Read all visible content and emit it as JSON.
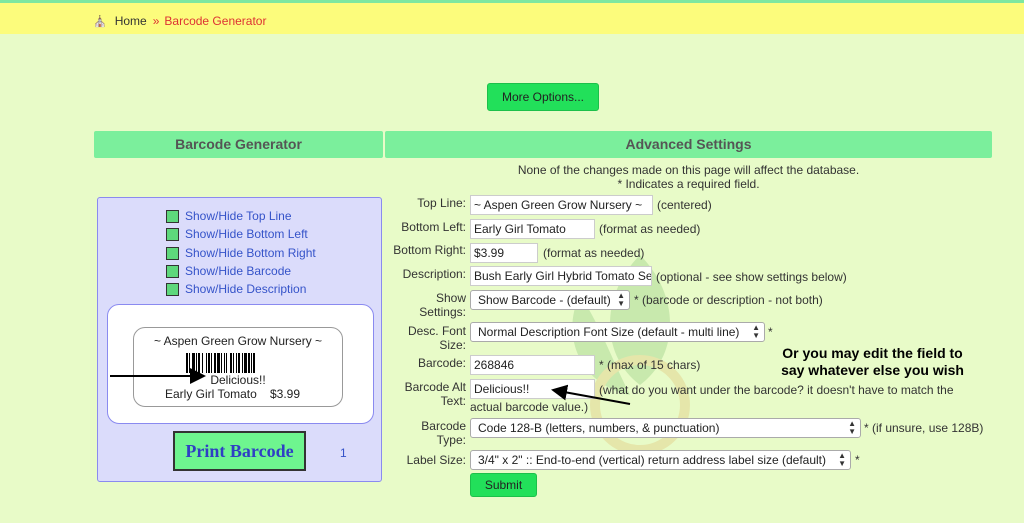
{
  "breadcrumb": {
    "home": "Home",
    "separator": "»",
    "current": "Barcode Generator"
  },
  "more_options_label": "More Options...",
  "left_panel": {
    "title": "Barcode Generator",
    "toggles": [
      "Show/Hide Top Line",
      "Show/Hide Bottom Left",
      "Show/Hide Bottom Right",
      "Show/Hide Barcode",
      "Show/Hide Description"
    ],
    "preview": {
      "top_line": "~ Aspen Green Grow Nursery ~",
      "barcode_alt_text": "Delicious!!",
      "bottom_left": "Early Girl Tomato",
      "bottom_right": "$3.99"
    },
    "print_button": "Print Barcode",
    "copies": "1"
  },
  "advanced": {
    "title": "Advanced Settings",
    "notice1": "None of the changes made on this page will affect the database.",
    "notice2": "* Indicates a required field.",
    "fields": {
      "top_line": {
        "label": "Top Line:",
        "value": "~ Aspen Green Grow Nursery ~",
        "hint": "(centered)"
      },
      "bottom_left": {
        "label": "Bottom Left:",
        "value": "Early Girl Tomato",
        "hint": "(format as needed)"
      },
      "bottom_right": {
        "label": "Bottom Right:",
        "value": "$3.99",
        "hint": "(format as needed)"
      },
      "description": {
        "label": "Description:",
        "value": "Bush Early Girl Hybrid Tomato Se",
        "hint": "(optional - see show settings below)"
      },
      "show_settings": {
        "label_line1": "Show",
        "label_line2": "Settings:",
        "value": "Show Barcode - (default)",
        "hint": "* (barcode or description - not both)"
      },
      "desc_font_size": {
        "label_line1": "Desc. Font",
        "label_line2": "Size:",
        "value": "Normal Description Font Size (default - multi line)",
        "hint": "*"
      },
      "barcode": {
        "label": "Barcode:",
        "value": "268846",
        "hint": "* (max of 15 chars)"
      },
      "barcode_alt_text": {
        "label_line1": "Barcode Alt",
        "label_line2": "Text:",
        "value": "Delicious!!",
        "hint_line1": "(what do you want under the barcode? it doesn't have to match the",
        "hint_line2": "actual barcode value.)"
      },
      "barcode_type": {
        "label_line1": "Barcode",
        "label_line2": "Type:",
        "value": "Code 128-B (letters, numbers, & punctuation)",
        "hint": "* (if unsure, use 128B)"
      },
      "label_size": {
        "label": "Label Size:",
        "value": "3/4\" x 2\" :: End-to-end (vertical) return address label size (default)",
        "hint": "*"
      }
    },
    "submit_label": "Submit"
  },
  "annotation": {
    "line1": "Or you may edit the field to",
    "line2": "say whatever else you wish"
  },
  "colors": {
    "page_bg": "#e8fbc8",
    "breadcrumb_bg": "#fcfc7c",
    "header_green": "#7bef9c",
    "button_green": "#22e05a",
    "link_blue": "#3553c9",
    "accent_red": "#dd3333"
  }
}
